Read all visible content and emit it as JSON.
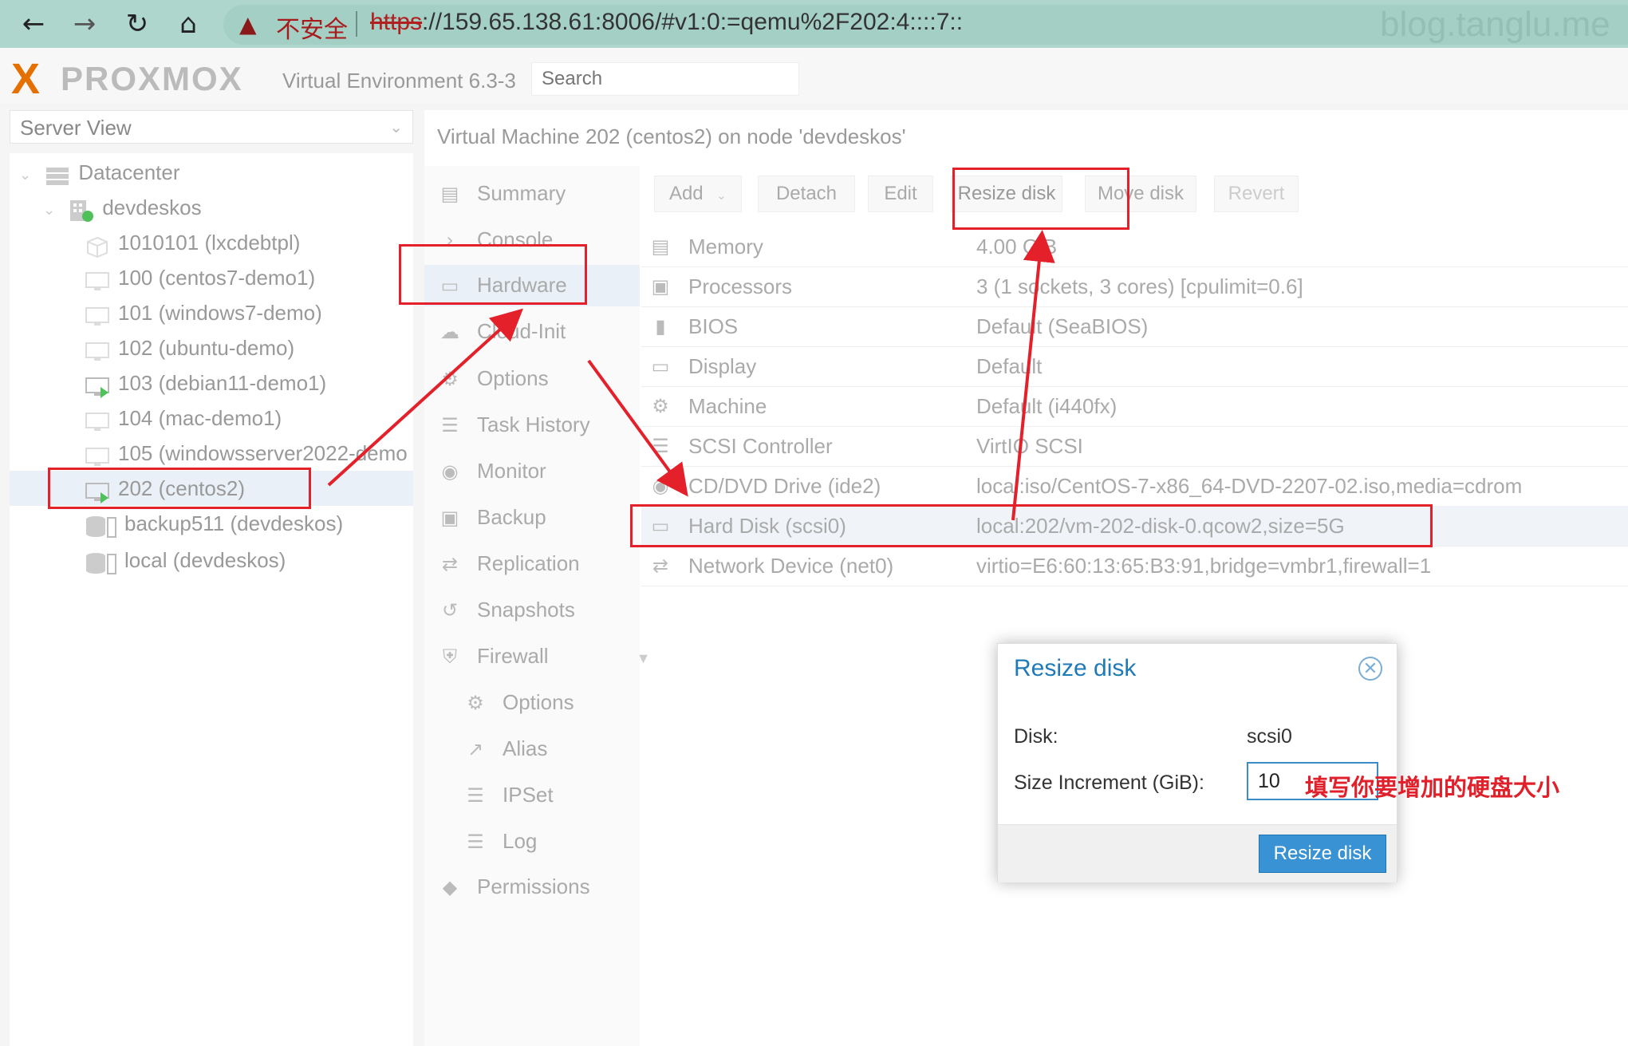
{
  "browser": {
    "warning": "不安全",
    "url_scheme": "https",
    "url_rest": "://159.65.138.61:8006/#v1:0:=qemu%2F202:4::::7::",
    "watermark": "blog.tanglu.me"
  },
  "header": {
    "logo_x": "X",
    "logo_text": "PROXMOX",
    "product": "Virtual Environment 6.3-3",
    "search_placeholder": "Search"
  },
  "server_view": {
    "label": "Server View"
  },
  "tree": [
    {
      "label": "Datacenter",
      "icon": "datacenter-icon"
    },
    {
      "label": "devdeskos",
      "icon": "node-icon"
    },
    {
      "label": "1010101 (lxcdebtpl)",
      "icon": "container-template-icon"
    },
    {
      "label": "100 (centos7-demo1)",
      "icon": "vm-icon"
    },
    {
      "label": "101 (windows7-demo)",
      "icon": "vm-icon"
    },
    {
      "label": "102 (ubuntu-demo)",
      "icon": "vm-icon"
    },
    {
      "label": "103 (debian11-demo1)",
      "icon": "vm-running-icon"
    },
    {
      "label": "104 (mac-demo1)",
      "icon": "vm-icon"
    },
    {
      "label": "105 (windowsserver2022-demo",
      "icon": "vm-icon"
    },
    {
      "label": "202 (centos2)",
      "icon": "vm-running-icon"
    },
    {
      "label": "backup511 (devdeskos)",
      "icon": "storage-icon"
    },
    {
      "label": "local (devdeskos)",
      "icon": "storage-icon"
    }
  ],
  "vm_title": "Virtual Machine 202 (centos2) on node 'devdeskos'",
  "menu": [
    {
      "label": "Summary",
      "icon": "summary-icon"
    },
    {
      "label": "Console",
      "icon": "console-icon"
    },
    {
      "label": "Hardware",
      "icon": "hardware-icon"
    },
    {
      "label": "Cloud-Init",
      "icon": "cloud-icon"
    },
    {
      "label": "Options",
      "icon": "gear-icon"
    },
    {
      "label": "Task History",
      "icon": "list-icon"
    },
    {
      "label": "Monitor",
      "icon": "eye-icon"
    },
    {
      "label": "Backup",
      "icon": "floppy-icon"
    },
    {
      "label": "Replication",
      "icon": "retweet-icon"
    },
    {
      "label": "Snapshots",
      "icon": "history-icon"
    },
    {
      "label": "Firewall",
      "icon": "shield-icon"
    },
    {
      "label": "Options",
      "icon": "gear-icon"
    },
    {
      "label": "Alias",
      "icon": "external-link-icon"
    },
    {
      "label": "IPSet",
      "icon": "list-ol-icon"
    },
    {
      "label": "Log",
      "icon": "list-icon"
    },
    {
      "label": "Permissions",
      "icon": "unlock-icon"
    }
  ],
  "toolbar": {
    "add": "Add",
    "detach": "Detach",
    "edit": "Edit",
    "resize": "Resize disk",
    "move": "Move disk",
    "revert": "Revert"
  },
  "hardware": [
    {
      "name": "Memory",
      "value": "4.00 GiB",
      "icon": "memory-icon"
    },
    {
      "name": "Processors",
      "value": "3 (1 sockets, 3 cores) [cpulimit=0.6]",
      "icon": "cpu-icon"
    },
    {
      "name": "BIOS",
      "value": "Default (SeaBIOS)",
      "icon": "bios-icon"
    },
    {
      "name": "Display",
      "value": "Default",
      "icon": "display-icon"
    },
    {
      "name": "Machine",
      "value": "Default (i440fx)",
      "icon": "cogs-icon"
    },
    {
      "name": "SCSI Controller",
      "value": "VirtIO SCSI",
      "icon": "database-icon"
    },
    {
      "name": "CD/DVD Drive (ide2)",
      "value": "local:iso/CentOS-7-x86_64-DVD-2207-02.iso,media=cdrom",
      "icon": "cdrom-icon"
    },
    {
      "name": "Hard Disk (scsi0)",
      "value": "local:202/vm-202-disk-0.qcow2,size=5G",
      "icon": "harddisk-icon"
    },
    {
      "name": "Network Device (net0)",
      "value": "virtio=E6:60:13:65:B3:91,bridge=vmbr1,firewall=1",
      "icon": "exchange-icon"
    }
  ],
  "dialog": {
    "title": "Resize disk",
    "disk_label": "Disk:",
    "disk_value": "scsi0",
    "size_label": "Size Increment (GiB):",
    "size_value": "10",
    "submit": "Resize disk"
  },
  "annotation": "填写你要增加的硬盘大小",
  "colors": {
    "accent": "#3892d3",
    "annotation": "#e4202a",
    "logo": "#e57000"
  }
}
